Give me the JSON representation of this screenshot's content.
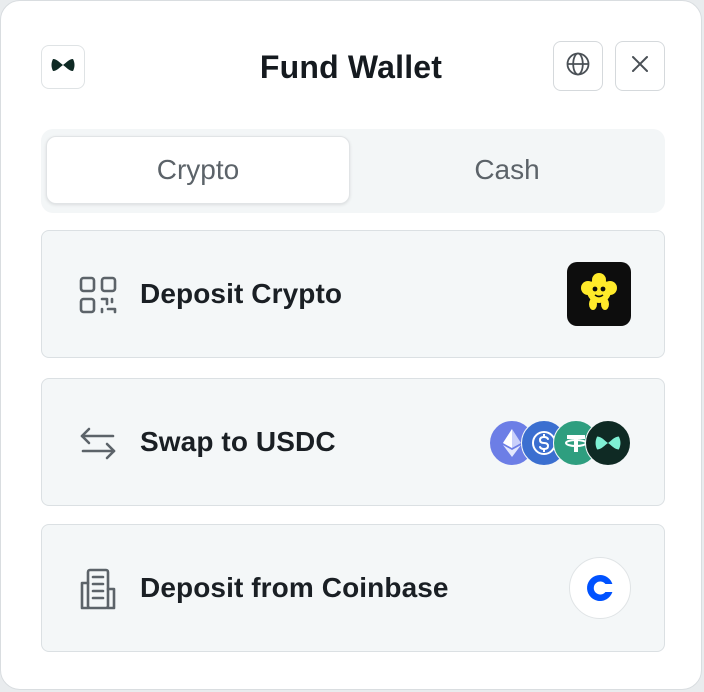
{
  "header": {
    "title": "Fund Wallet",
    "logo_icon": "wallet-logo-icon",
    "globe_icon": "globe-icon",
    "close_icon": "close-icon"
  },
  "tabs": [
    {
      "label": "Crypto",
      "active": true
    },
    {
      "label": "Cash",
      "active": false
    }
  ],
  "options": [
    {
      "label": "Deposit Crypto",
      "icon": "qr-code-icon",
      "badge": "mascot-icon"
    },
    {
      "label": "Swap to USDC",
      "icon": "swap-arrows-icon",
      "badges": [
        "ethereum-icon",
        "usdc-icon",
        "tether-icon",
        "wallet-logo-icon"
      ]
    },
    {
      "label": "Deposit from Coinbase",
      "icon": "building-icon",
      "badge": "coinbase-icon"
    }
  ],
  "colors": {
    "mascot": "#ffea2a",
    "ethereum": "#6c7ee6",
    "usdc": "#3b6fd0",
    "tether": "#2e9e7f",
    "wallet_logo": "#0f2a24",
    "coinbase": "#0052ff"
  }
}
